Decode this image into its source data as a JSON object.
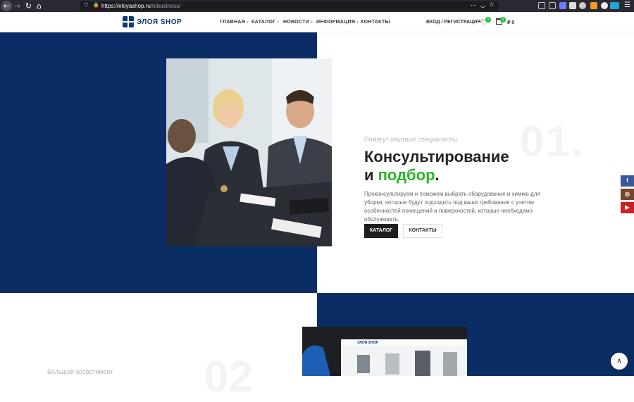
{
  "browser": {
    "url_host": "https://eloyashop.ru",
    "url_path": "/tobusiness/"
  },
  "header": {
    "logo_text": "ЭЛОЯ  SHOP",
    "menu": [
      {
        "label": "ГЛАВНАЯ"
      },
      {
        "label": "КАТАЛОГ"
      },
      {
        "label": "НОВОСТИ"
      },
      {
        "label": "ИНФОРМАЦИЯ"
      },
      {
        "label": "КОНТАКТЫ"
      }
    ],
    "login": "ВХОД / РЕГИСТРАЦИЯ",
    "wishlist_count": "0",
    "cart_count": "0",
    "cart_total": "₽ 0"
  },
  "hero": {
    "number": "01.",
    "subtitle": "Помогут опытные специалисты",
    "title_line1": "Консультирование",
    "title_line2_prefix": "и ",
    "title_line2_highlight": "подбор",
    "title_line2_suffix": ".",
    "description": "Проконсультируем и поможем выбрать оборудование и химию для уборки, которые будут подходить под ваши требования с учетом особенностей помещений и поверхностей, которые необходимо обслуживать.",
    "btn_catalog": "КАТАЛОГ",
    "btn_contacts": "КОНТАКТЫ"
  },
  "social": [
    {
      "name": "facebook",
      "glyph": "f",
      "color": "#3b5998"
    },
    {
      "name": "instagram",
      "glyph": "◎",
      "color": "#774430"
    },
    {
      "name": "youtube",
      "glyph": "▶",
      "color": "#cb2027"
    }
  ],
  "section2": {
    "number": "02",
    "subtitle": "Большой ассортимент",
    "screen_logo": "ЭЛОЯ SHOP"
  },
  "colors": {
    "navy": "#0b2d65",
    "accent_green": "#2bb52a"
  }
}
